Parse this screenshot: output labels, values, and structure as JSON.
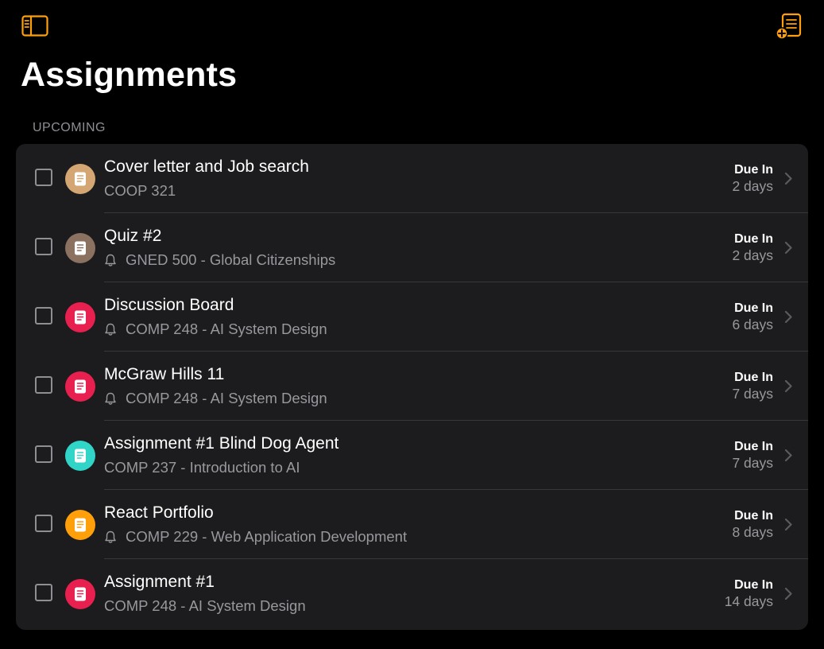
{
  "colors": {
    "accent": "#ff9f0a",
    "background": "#000000",
    "card": "#1c1c1e"
  },
  "toolbar": {
    "sidebar_icon": "sidebar-toggle-icon",
    "add_icon": "add-assignment-icon"
  },
  "page": {
    "title": "Assignments",
    "section": "UPCOMING"
  },
  "assignments": [
    {
      "title": "Cover letter and Job search",
      "course": "COOP 321",
      "has_reminder": false,
      "due_label": "Due In",
      "due_value": "2 days",
      "color": "#d4a673"
    },
    {
      "title": "Quiz #2",
      "course": "GNED 500 - Global Citizenships",
      "has_reminder": true,
      "due_label": "Due In",
      "due_value": "2 days",
      "color": "#8b7160"
    },
    {
      "title": "Discussion Board",
      "course": "COMP 248 - AI System Design",
      "has_reminder": true,
      "due_label": "Due In",
      "due_value": "6 days",
      "color": "#e8204f"
    },
    {
      "title": "McGraw Hills 11",
      "course": "COMP 248 - AI System Design",
      "has_reminder": true,
      "due_label": "Due In",
      "due_value": "7 days",
      "color": "#e8204f"
    },
    {
      "title": "Assignment #1 Blind Dog Agent",
      "course": "COMP 237 - Introduction to AI",
      "has_reminder": false,
      "due_label": "Due In",
      "due_value": "7 days",
      "color": "#30d5c8"
    },
    {
      "title": "React Portfolio",
      "course": "COMP 229 - Web Application Development",
      "has_reminder": true,
      "due_label": "Due In",
      "due_value": "8 days",
      "color": "#ff9f0a"
    },
    {
      "title": "Assignment #1",
      "course": "COMP 248 - AI System Design",
      "has_reminder": false,
      "due_label": "Due In",
      "due_value": "14 days",
      "color": "#e8204f"
    }
  ]
}
